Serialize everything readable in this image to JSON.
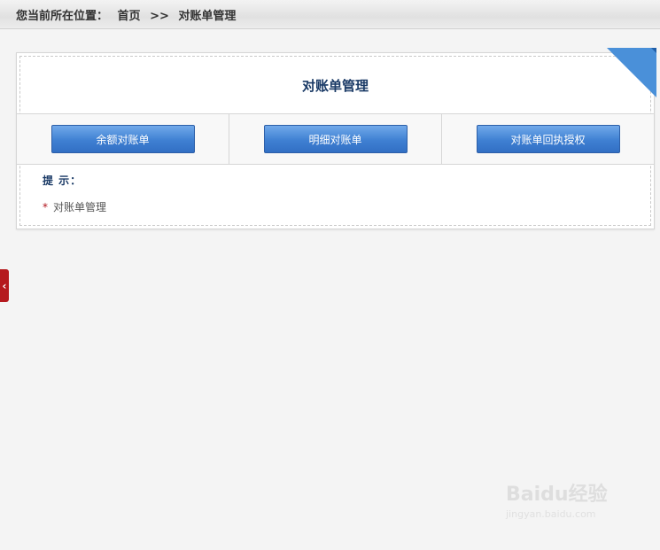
{
  "breadcrumb": {
    "label": "您当前所在位置：",
    "home": "首页",
    "separator": ">>",
    "current": "对账单管理"
  },
  "panel": {
    "title": "对账单管理",
    "buttons": [
      {
        "label": "余额对账单"
      },
      {
        "label": "明细对账单"
      },
      {
        "label": "对账单回执授权"
      }
    ],
    "tip_label": "提 示：",
    "tip_items": [
      {
        "star": "*",
        "text": "对账单管理"
      }
    ]
  },
  "side_tab": {
    "icon": "chevron-left-icon",
    "glyph": "‹"
  },
  "watermark": {
    "top": "Baidu经验",
    "bottom": "jingyan.baidu.com"
  },
  "colors": {
    "accent": "#4a90d9",
    "button": "#3f80d2",
    "title": "#1a3a66",
    "side_tab": "#b51a1e"
  }
}
